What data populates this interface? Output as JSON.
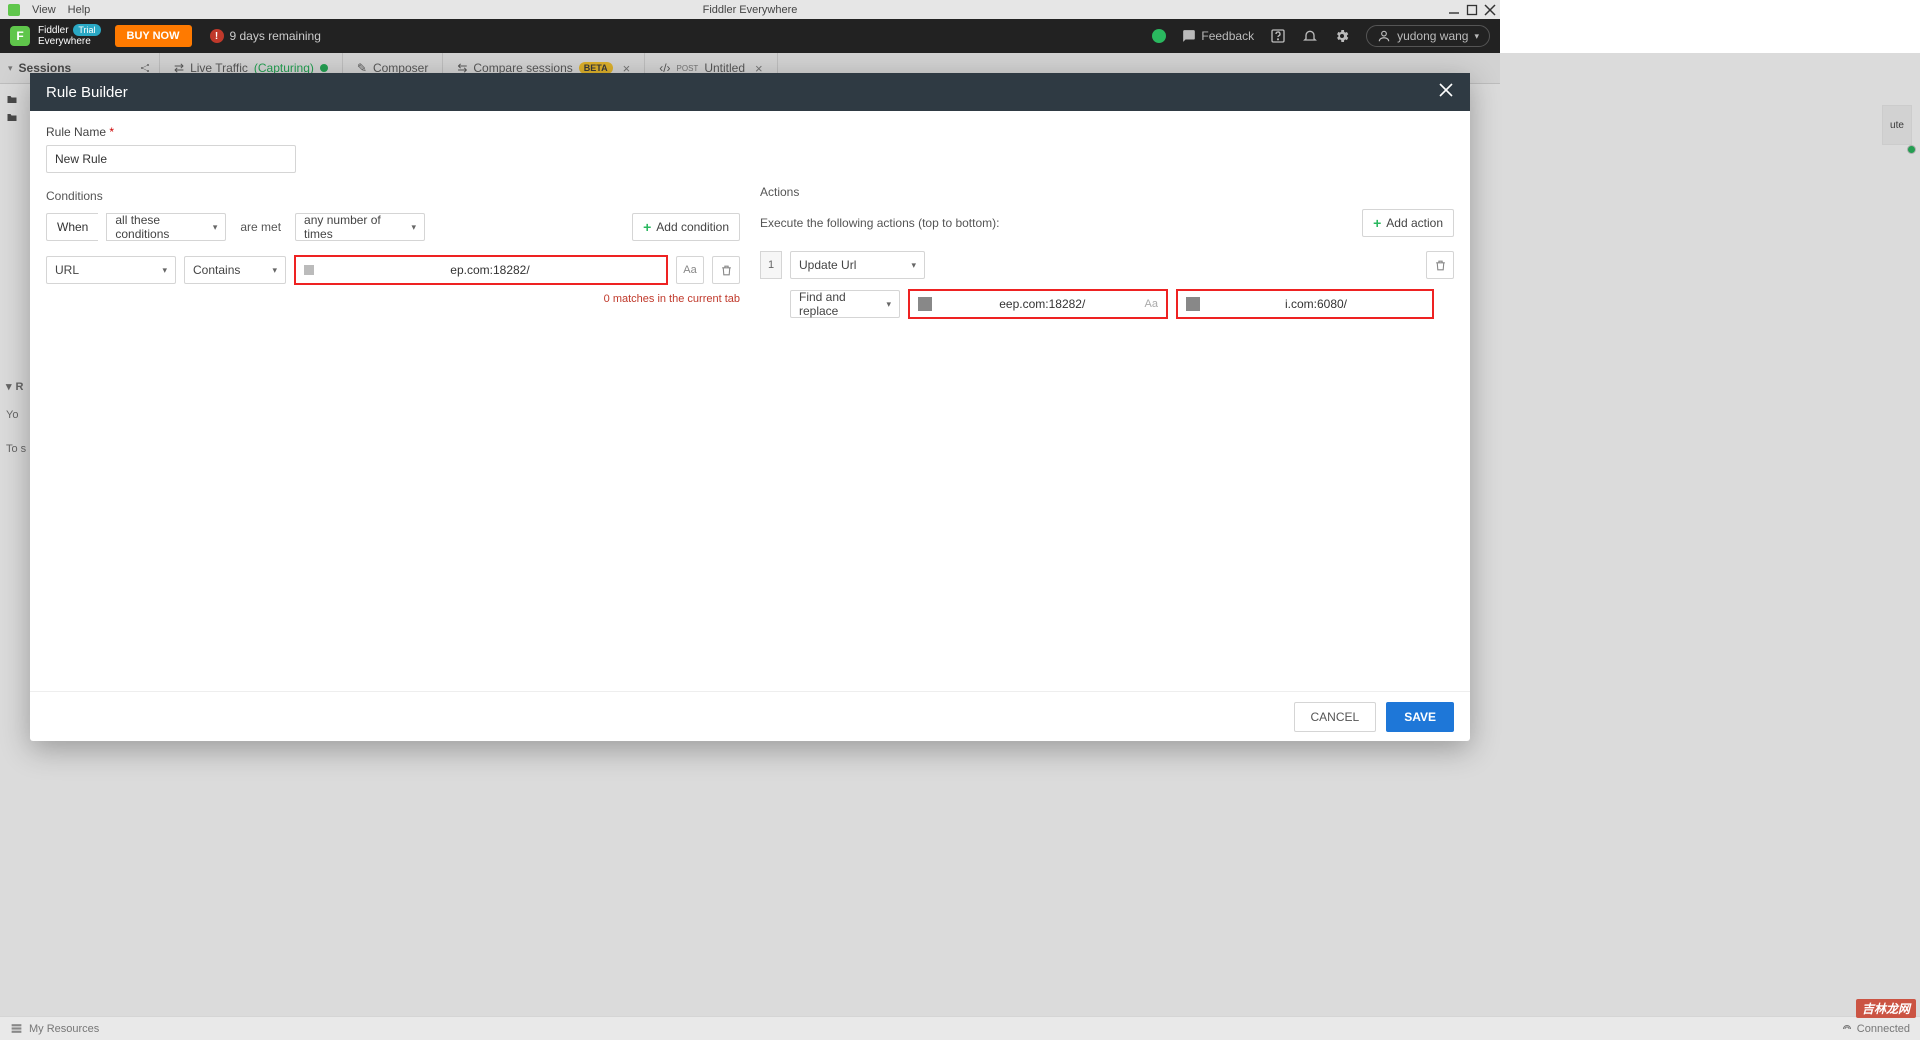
{
  "os": {
    "menu_view": "View",
    "menu_help": "Help",
    "app_title": "Fiddler Everywhere"
  },
  "header": {
    "brand_letter": "F",
    "brand_line1": "Fiddler",
    "brand_line2": "Everywhere",
    "trial_badge": "Trial",
    "buy": "BUY NOW",
    "days": "9 days remaining",
    "feedback": "Feedback",
    "user": "yudong wang"
  },
  "sessions": {
    "title": "Sessions"
  },
  "tabs": {
    "live": "Live Traffic",
    "live_state": "(Capturing)",
    "composer": "Composer",
    "compare": "Compare sessions",
    "beta": "BETA",
    "untitled": "Untitled",
    "post": "POST"
  },
  "right_peek": "ute",
  "left": {
    "r_row": "R",
    "yo_row": "Yo",
    "tos_row": "To s"
  },
  "modal": {
    "title": "Rule Builder",
    "rule_name_label": "Rule Name",
    "rule_name_value": "New Rule",
    "conditions_title": "Conditions",
    "when_label": "When",
    "when_value": "all these conditions",
    "are_met_label": "are met",
    "times_value": "any number of times",
    "add_condition": "Add condition",
    "cond_field": "URL",
    "cond_op": "Contains",
    "cond_value": "ep.com:18282/",
    "aa": "Aa",
    "matches_msg": "0 matches in the current tab",
    "actions_title": "Actions",
    "exec_label": "Execute the following actions (top to bottom):",
    "add_action": "Add action",
    "action_num": "1",
    "action_type": "Update Url",
    "find_replace": "Find and replace",
    "find_value": "eep.com:18282/",
    "replace_value": "i.com:6080/",
    "cancel": "CANCEL",
    "save": "SAVE"
  },
  "status": {
    "resources": "My Resources",
    "connected": "Connected"
  },
  "watermark": "吉林龙网"
}
